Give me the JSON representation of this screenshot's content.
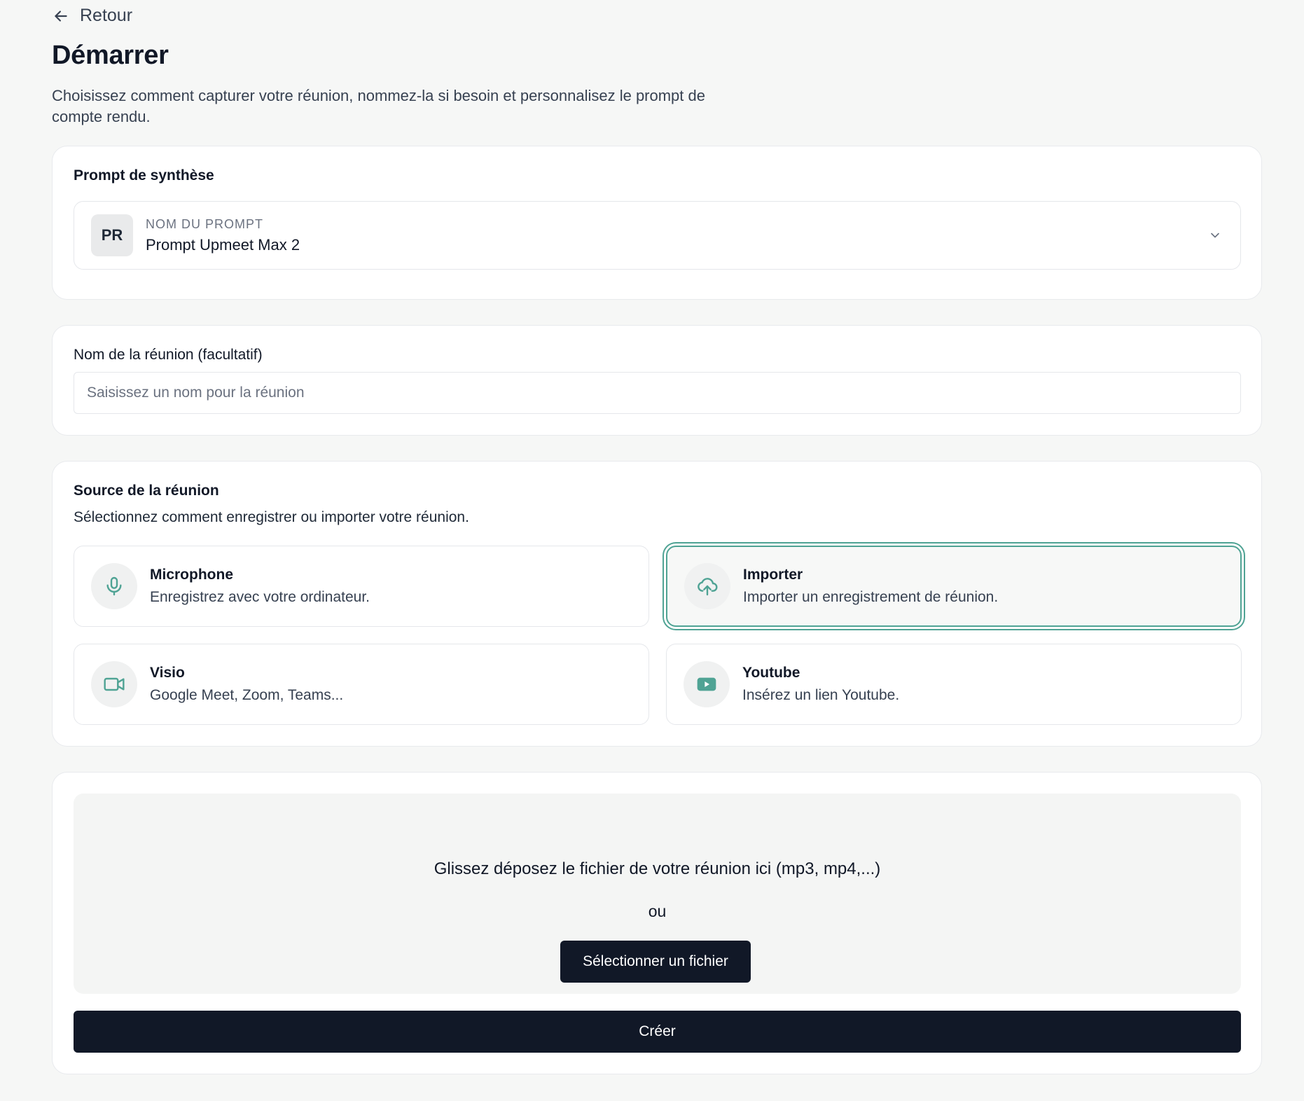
{
  "header": {
    "back_label": "Retour",
    "title": "Démarrer",
    "subtitle": "Choisissez comment capturer votre réunion, nommez-la si besoin et personnalisez le prompt de compte rendu."
  },
  "prompt_card": {
    "label": "Prompt de synthèse",
    "avatar_initials": "PR",
    "caption": "NOM DU PROMPT",
    "selected_value": "Prompt Upmeet Max 2",
    "dropdown_icon": "chevron-down-icon"
  },
  "name_card": {
    "label": "Nom de la réunion (facultatif)",
    "input_value": "",
    "placeholder": "Saisissez un nom pour la réunion"
  },
  "source_card": {
    "label": "Source de la réunion",
    "description": "Sélectionnez comment enregistrer ou importer votre réunion.",
    "selected": "importer",
    "options": [
      {
        "id": "microphone",
        "icon": "microphone-icon",
        "title": "Microphone",
        "subtitle": "Enregistrez avec votre ordinateur."
      },
      {
        "id": "importer",
        "icon": "cloud-upload-icon",
        "title": "Importer",
        "subtitle": "Importer un enregistrement de réunion."
      },
      {
        "id": "visio",
        "icon": "video-camera-icon",
        "title": "Visio",
        "subtitle": "Google Meet, Zoom, Teams..."
      },
      {
        "id": "youtube",
        "icon": "youtube-icon",
        "title": "Youtube",
        "subtitle": "Insérez un lien Youtube."
      }
    ]
  },
  "upload_card": {
    "drop_text": "Glissez déposez le fichier de votre réunion ici (mp3, mp4,...)",
    "or_text": "ou",
    "select_button": "Sélectionner un fichier",
    "create_button": "Créer"
  },
  "colors": {
    "accent": "#4fa394",
    "primary_button": "#111827",
    "background": "#f6f7f6"
  }
}
